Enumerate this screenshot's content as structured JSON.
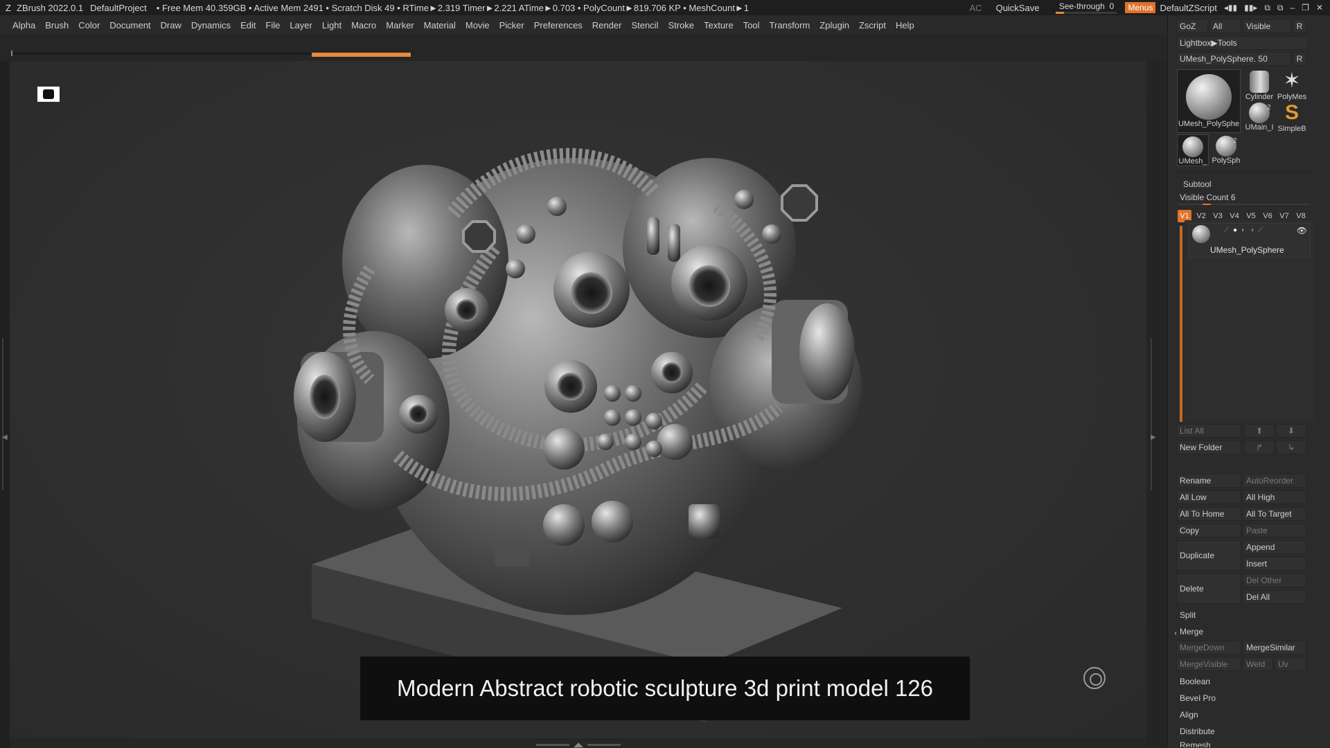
{
  "titlebar": {
    "app": "ZBrush 2022.0.1",
    "project": "DefaultProject",
    "stats": "• Free Mem 40.359GB • Active Mem 2491 • Scratch Disk 49 •  RTime►2.319 Timer►2.221 ATime►0.703 • PolyCount►819.706 KP  • MeshCount►1",
    "ac": "AC",
    "quicksave": "QuickSave",
    "seethrough_label": "See-through",
    "seethrough_value": "0",
    "menus": "Menus",
    "zscript": "DefaultZScript"
  },
  "menubar": [
    "Alpha",
    "Brush",
    "Color",
    "Document",
    "Draw",
    "Dynamics",
    "Edit",
    "File",
    "Layer",
    "Light",
    "Macro",
    "Marker",
    "Material",
    "Movie",
    "Picker",
    "Preferences",
    "Render",
    "Stencil",
    "Stroke",
    "Texture",
    "Tool",
    "Transform",
    "Zplugin",
    "Zscript",
    "Help"
  ],
  "viewport": {
    "caption": "Modern Abstract robotic sculpture 3d print model 126"
  },
  "panel": {
    "goz": "GoZ",
    "all": "All",
    "visible": "Visible",
    "r": "R",
    "lightbox_tools": "Lightbox▶Tools",
    "current_tool": "UMesh_PolySphere. 50",
    "tools": [
      {
        "label": "UMesh_PolySphe"
      },
      {
        "label": "Cylinder"
      },
      {
        "label": "PolyMes"
      },
      {
        "label": "UMain_I"
      },
      {
        "label": "SimpleB"
      },
      {
        "label": "UMesh_"
      },
      {
        "label": "PolySph"
      }
    ],
    "badge_2a": "2",
    "badge_2b": "2",
    "subtool_title": "Subtool",
    "visible_count": "Visible Count 6",
    "vtabs": [
      "V1",
      "V2",
      "V3",
      "V4",
      "V5",
      "V6",
      "V7",
      "V8"
    ],
    "subtool_item": "UMesh_PolySphere",
    "list_all": "List All",
    "new_folder": "New Folder",
    "rename": "Rename",
    "autoreorder": "AutoReorder",
    "all_low": "All Low",
    "all_high": "All High",
    "all_to_home": "All To Home",
    "all_to_target": "All To Target",
    "copy": "Copy",
    "paste": "Paste",
    "duplicate": "Duplicate",
    "append": "Append",
    "insert": "Insert",
    "delete": "Delete",
    "del_other": "Del Other",
    "del_all": "Del All",
    "split": "Split",
    "merge": "Merge",
    "mergedown": "MergeDown",
    "mergesimilar": "MergeSimilar",
    "mergevisible": "MergeVisible",
    "weld": "Weld",
    "uv": "Uv",
    "boolean": "Boolean",
    "bevel_pro": "Bevel Pro",
    "align": "Align",
    "distribute": "Distribute",
    "remesh": "Remesh"
  }
}
